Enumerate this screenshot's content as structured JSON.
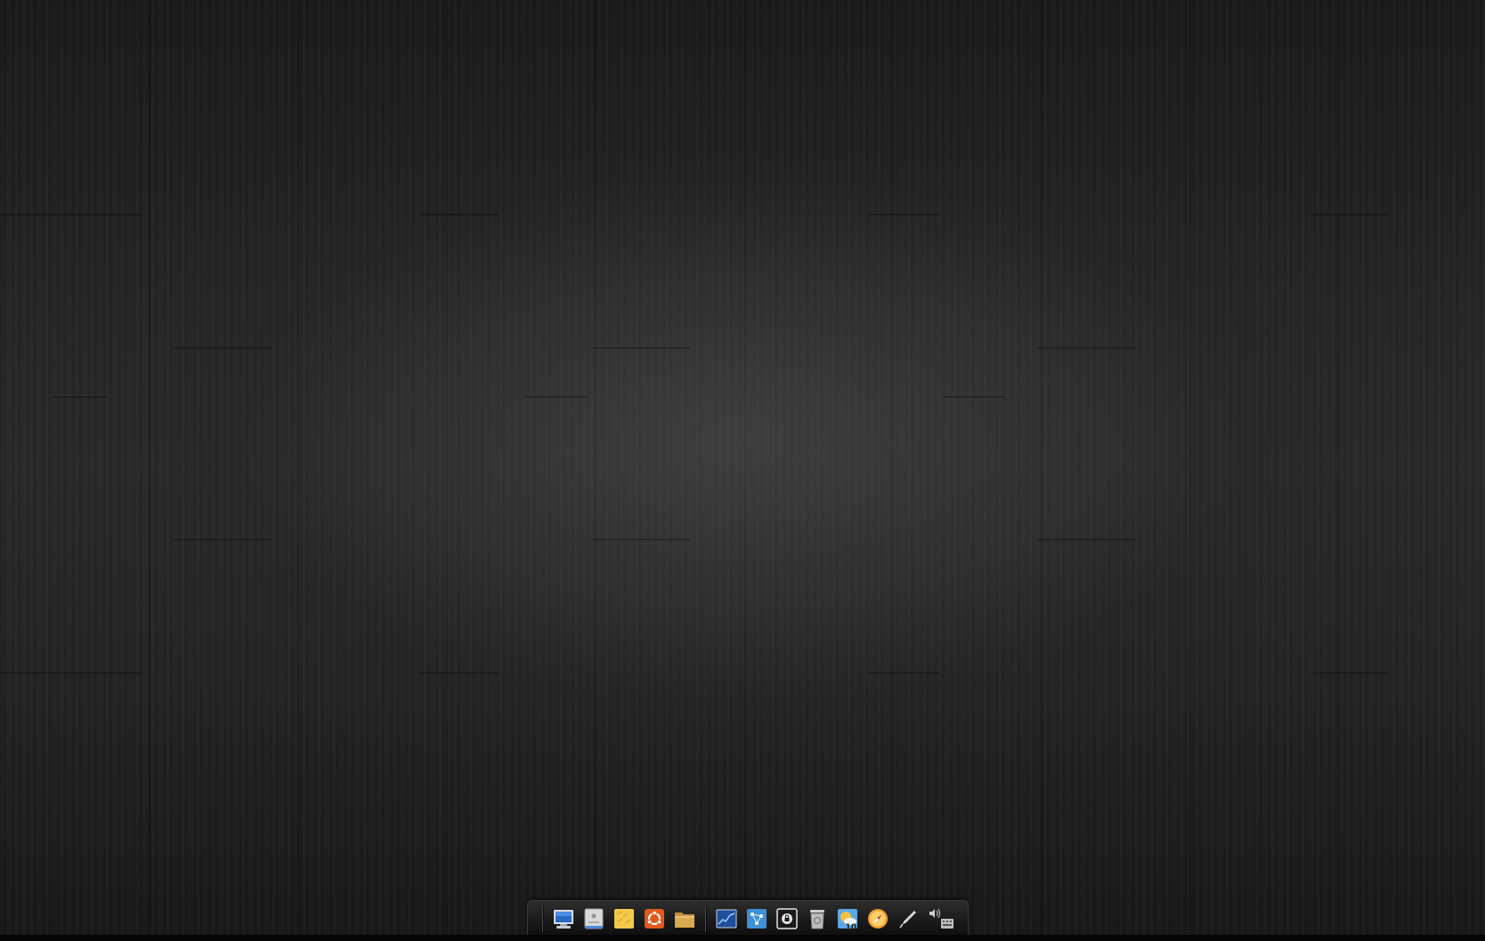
{
  "desktop": {
    "wallpaper": "dark-wood-planks"
  },
  "dock": {
    "launchers": [
      {
        "name": "computer-icon"
      },
      {
        "name": "disk-utility-icon"
      },
      {
        "name": "sticky-notes-icon"
      },
      {
        "name": "ubuntu-software-icon"
      },
      {
        "name": "folder-icon"
      }
    ],
    "apps": [
      {
        "name": "system-monitor-icon"
      },
      {
        "name": "network-icon"
      },
      {
        "name": "lock-screen-icon"
      },
      {
        "name": "trash-icon"
      },
      {
        "name": "weather-icon",
        "badge": "10"
      },
      {
        "name": "compass-browser-icon"
      },
      {
        "name": "pen-tool-icon"
      },
      {
        "name": "volume-icon"
      },
      {
        "name": "keyboard-icon"
      }
    ]
  },
  "colors": {
    "accent_orange": "#e05a1e",
    "folder_tan": "#d8a94e",
    "sticky_yellow": "#f2c94c",
    "monitor_blue": "#2a68c4"
  }
}
